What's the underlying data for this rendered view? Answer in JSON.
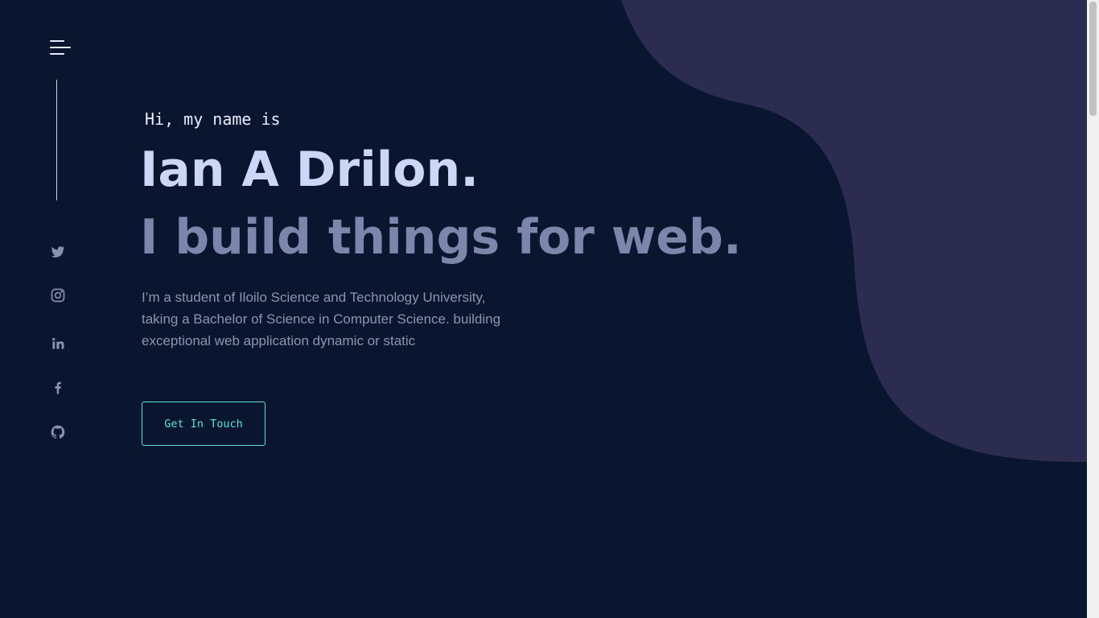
{
  "nav": {
    "menu_icon": "hamburger-menu-icon"
  },
  "social": [
    {
      "name": "twitter",
      "icon": "twitter-icon"
    },
    {
      "name": "instagram",
      "icon": "instagram-icon"
    },
    {
      "name": "linkedin",
      "icon": "linkedin-icon"
    },
    {
      "name": "facebook",
      "icon": "facebook-icon"
    },
    {
      "name": "github",
      "icon": "github-icon"
    }
  ],
  "hero": {
    "greeting": "Hi, my name is",
    "name": "Ian A Drilon.",
    "tagline": "I build things for web.",
    "bio": "I’m a student of Iloilo Science and Technology University, taking a Bachelor of Science in Computer Science. building exceptional web application dynamic or static",
    "cta_label": "Get In Touch"
  },
  "colors": {
    "background": "#0a1630",
    "blob": "#2c2c50",
    "heading": "#ccd6f6",
    "tagline": "#7b86aa",
    "accent": "#5de3d2",
    "icon": "#8892b0"
  }
}
